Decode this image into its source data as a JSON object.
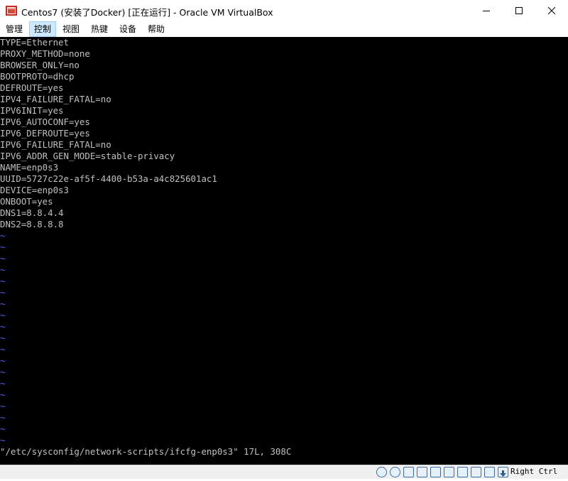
{
  "window": {
    "title": "Centos7 (安装了Docker) [正在运行] - Oracle VM VirtualBox"
  },
  "menu": {
    "items": [
      {
        "label": "管理"
      },
      {
        "label": "控制"
      },
      {
        "label": "视图"
      },
      {
        "label": "热键"
      },
      {
        "label": "设备"
      },
      {
        "label": "帮助"
      }
    ]
  },
  "console": {
    "lines": [
      "TYPE=Ethernet",
      "PROXY_METHOD=none",
      "BROWSER_ONLY=no",
      "BOOTPROTO=dhcp",
      "DEFROUTE=yes",
      "IPV4_FAILURE_FATAL=no",
      "IPV6INIT=yes",
      "IPV6_AUTOCONF=yes",
      "IPV6_DEFROUTE=yes",
      "IPV6_FAILURE_FATAL=no",
      "IPV6_ADDR_GEN_MODE=stable-privacy",
      "NAME=enp0s3",
      "UUID=5727c22e-af5f-4400-b53a-a4c825601ac1",
      "DEVICE=enp0s3",
      "ONBOOT=yes",
      "DNS1=8.8.4.4",
      "DNS2=8.8.8.8"
    ],
    "tilde_char": "~",
    "tilde_count": 19,
    "status_line": "\"/etc/sysconfig/network-scripts/ifcfg-enp0s3\" 17L, 308C",
    "text_color": "#c0c0c0",
    "tilde_color": "#5c5cff"
  },
  "statusbar": {
    "icons": [
      "hard-disk-icon",
      "optical-drive-icon",
      "audio-icon",
      "network-icon",
      "usb-icon",
      "shared-folder-icon",
      "display-icon",
      "video-capture-icon",
      "cpu-icon",
      "mouse-integration-icon",
      "keyboard-icon"
    ],
    "host_key": "Right Ctrl"
  }
}
